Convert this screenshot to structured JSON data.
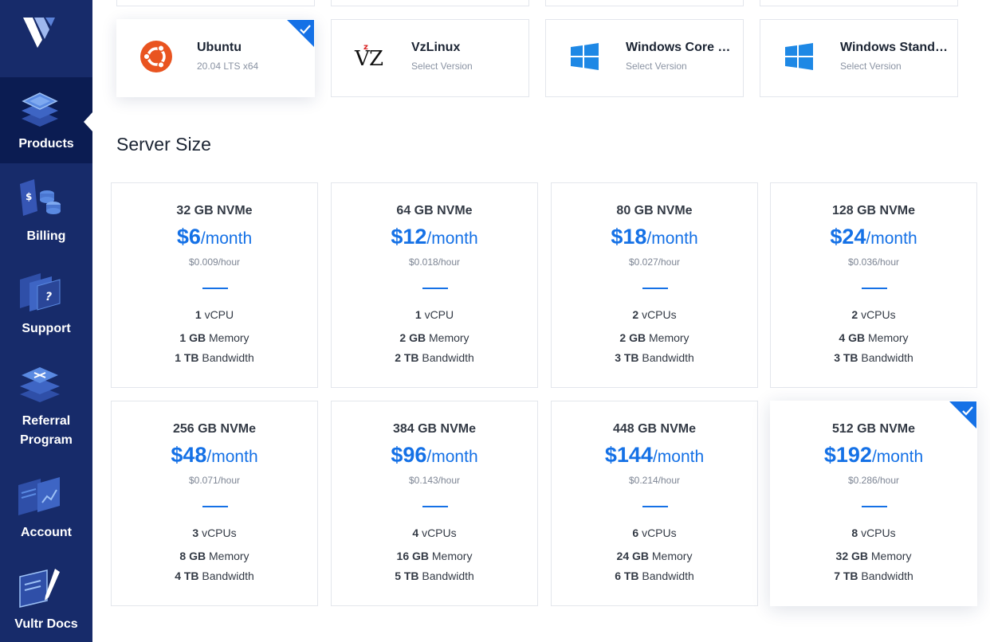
{
  "sidebar": {
    "items": [
      {
        "label": "Products",
        "icon": "products-icon",
        "active": true
      },
      {
        "label": "Billing",
        "icon": "billing-icon",
        "active": false
      },
      {
        "label": "Support",
        "icon": "support-icon",
        "active": false
      },
      {
        "label": "Referral Program",
        "icon": "referral-icon",
        "active": false
      },
      {
        "label": "Account",
        "icon": "account-icon",
        "active": false
      },
      {
        "label": "Vultr Docs",
        "icon": "docs-icon",
        "active": false
      }
    ]
  },
  "os": {
    "cards": [
      {
        "name": "Ubuntu",
        "sub": "20.04  LTS  x64",
        "icon": "ubuntu-icon",
        "selected": true
      },
      {
        "name": "VzLinux",
        "sub": "Select Version",
        "icon": "vzlinux-icon",
        "selected": false
      },
      {
        "name": "Windows Core S…",
        "sub": "Select Version",
        "icon": "windows-icon",
        "selected": false
      },
      {
        "name": "Windows Standa…",
        "sub": "Select Version",
        "icon": "windows-icon",
        "selected": false
      }
    ]
  },
  "server_size": {
    "title": "Server Size",
    "plans": [
      {
        "storage": "32 GB NVMe",
        "price": "$6",
        "unit": "/month",
        "hourly": "$0.009/hour",
        "cpu_n": "1",
        "cpu_t": "vCPU",
        "mem_n": "1 GB",
        "mem_t": "Memory",
        "bw_n": "1 TB",
        "bw_t": "Bandwidth",
        "selected": false
      },
      {
        "storage": "64 GB NVMe",
        "price": "$12",
        "unit": "/month",
        "hourly": "$0.018/hour",
        "cpu_n": "1",
        "cpu_t": "vCPU",
        "mem_n": "2 GB",
        "mem_t": "Memory",
        "bw_n": "2 TB",
        "bw_t": "Bandwidth",
        "selected": false
      },
      {
        "storage": "80 GB NVMe",
        "price": "$18",
        "unit": "/month",
        "hourly": "$0.027/hour",
        "cpu_n": "2",
        "cpu_t": "vCPUs",
        "mem_n": "2 GB",
        "mem_t": "Memory",
        "bw_n": "3 TB",
        "bw_t": "Bandwidth",
        "selected": false
      },
      {
        "storage": "128 GB NVMe",
        "price": "$24",
        "unit": "/month",
        "hourly": "$0.036/hour",
        "cpu_n": "2",
        "cpu_t": "vCPUs",
        "mem_n": "4 GB",
        "mem_t": "Memory",
        "bw_n": "3 TB",
        "bw_t": "Bandwidth",
        "selected": false
      },
      {
        "storage": "256 GB NVMe",
        "price": "$48",
        "unit": "/month",
        "hourly": "$0.071/hour",
        "cpu_n": "3",
        "cpu_t": "vCPUs",
        "mem_n": "8 GB",
        "mem_t": "Memory",
        "bw_n": "4 TB",
        "bw_t": "Bandwidth",
        "selected": false
      },
      {
        "storage": "384 GB NVMe",
        "price": "$96",
        "unit": "/month",
        "hourly": "$0.143/hour",
        "cpu_n": "4",
        "cpu_t": "vCPUs",
        "mem_n": "16 GB",
        "mem_t": "Memory",
        "bw_n": "5 TB",
        "bw_t": "Bandwidth",
        "selected": false
      },
      {
        "storage": "448 GB NVMe",
        "price": "$144",
        "unit": "/month",
        "hourly": "$0.214/hour",
        "cpu_n": "6",
        "cpu_t": "vCPUs",
        "mem_n": "24 GB",
        "mem_t": "Memory",
        "bw_n": "6 TB",
        "bw_t": "Bandwidth",
        "selected": false
      },
      {
        "storage": "512 GB NVMe",
        "price": "$192",
        "unit": "/month",
        "hourly": "$0.286/hour",
        "cpu_n": "8",
        "cpu_t": "vCPUs",
        "mem_n": "32 GB",
        "mem_t": "Memory",
        "bw_n": "7 TB",
        "bw_t": "Bandwidth",
        "selected": true
      }
    ]
  },
  "colors": {
    "sidebar_bg": "#172b6a",
    "sidebar_active": "#0b1c52",
    "accent_blue": "#1571e6",
    "ubuntu_orange": "#e95420"
  }
}
